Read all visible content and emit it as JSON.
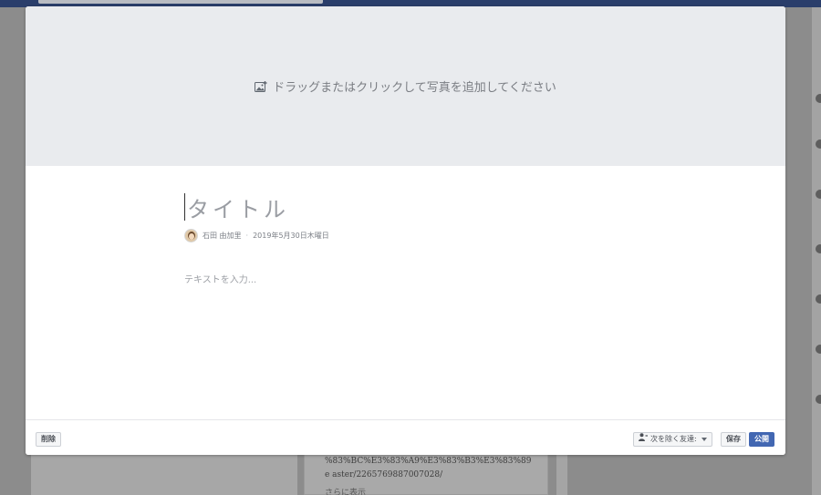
{
  "photo_upload": {
    "label": "ドラッグまたはクリックして写真を追加してください",
    "icon": "add-photo-icon"
  },
  "note": {
    "title_placeholder": "タイトル",
    "author": "石田 由加里",
    "separator": "·",
    "date": "2019年5月30日木曜日",
    "body_placeholder": "テキストを入力..."
  },
  "footer": {
    "delete_label": "削除",
    "privacy_label": "次を除く友達:",
    "save_label": "保存",
    "publish_label": "公開"
  },
  "background": {
    "url_text": "%83%BC%E3%83%A9%E3%83%B3%E3%83%89e aster/2265769887007028/",
    "more_label": "さらに表示"
  },
  "colors": {
    "accent": "#4267b2",
    "overlay": "#8c8c8c",
    "photo_zone": "#e9ebee"
  }
}
